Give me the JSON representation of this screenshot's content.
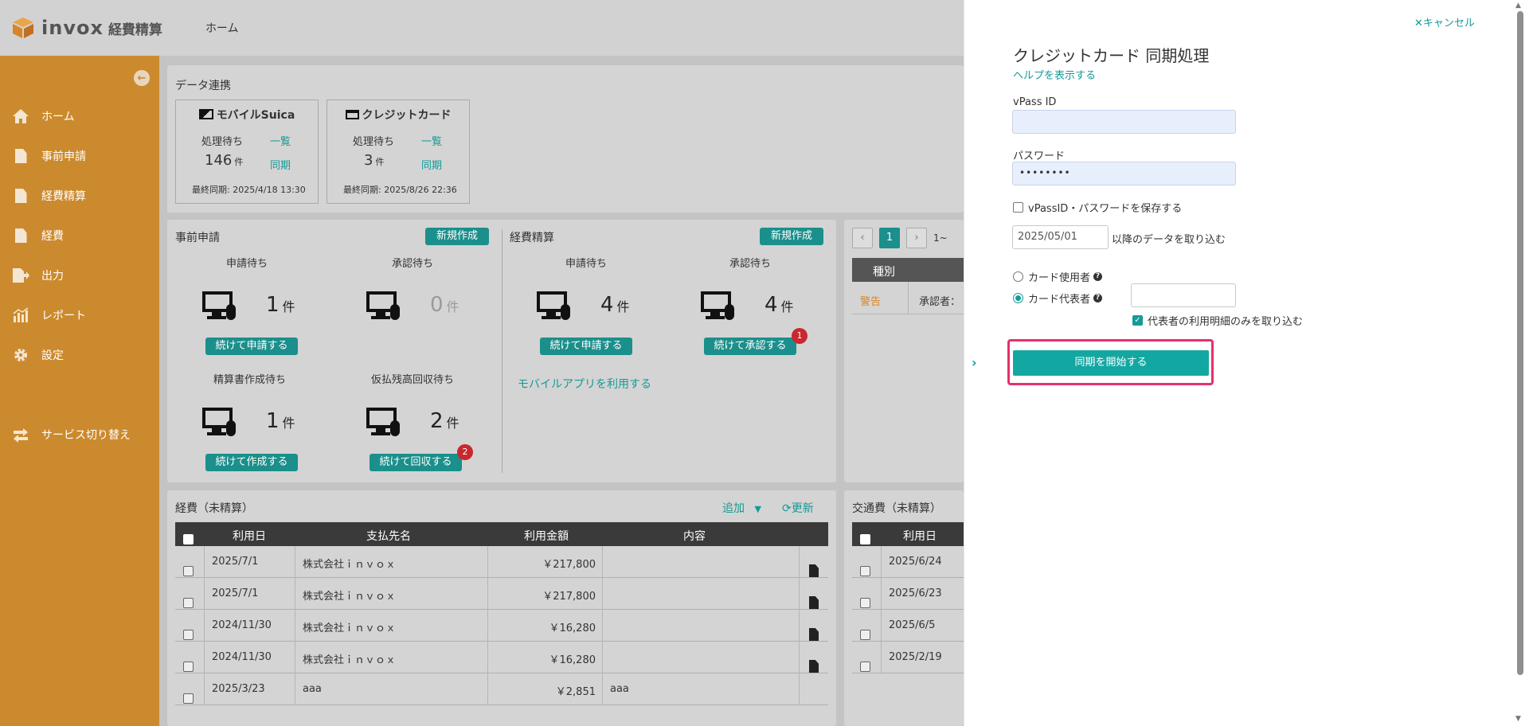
{
  "header": {
    "logo_text": "invox",
    "logo_sub": "経費精算",
    "home_link": "ホーム"
  },
  "sidebar": {
    "items": [
      {
        "label": "ホーム",
        "icon": "home-icon"
      },
      {
        "label": "事前申請",
        "icon": "document-icon"
      },
      {
        "label": "経費精算",
        "icon": "document-icon"
      },
      {
        "label": "経費",
        "icon": "document-icon"
      },
      {
        "label": "出力",
        "icon": "export-icon"
      },
      {
        "label": "レポート",
        "icon": "chart-icon"
      },
      {
        "label": "設定",
        "icon": "gear-icon"
      },
      {
        "label": "サービス切り替え",
        "icon": "switch-icon"
      }
    ]
  },
  "data_link": {
    "title": "データ連携",
    "suica": {
      "title": "モバイルSuica",
      "pending_label": "処理待ち",
      "count": "146",
      "unit": "件",
      "list_link": "一覧",
      "sync_link": "同期",
      "last_sync": "最終同期: 2025/4/18 13:30"
    },
    "credit": {
      "title": "クレジットカード",
      "pending_label": "処理待ち",
      "count": "3",
      "unit": "件",
      "list_link": "一覧",
      "sync_link": "同期",
      "last_sync": "最終同期: 2025/8/26 22:36"
    }
  },
  "pre_app": {
    "title": "事前申請",
    "new_button": "新規作成",
    "blocks": [
      {
        "label": "申請待ち",
        "count": "1",
        "unit": "件",
        "button": "続けて申請する"
      },
      {
        "label": "承認待ち",
        "count": "0",
        "unit": "件"
      },
      {
        "label": "精算書作成待ち",
        "count": "1",
        "unit": "件",
        "button": "続けて作成する"
      },
      {
        "label": "仮払残高回収待ち",
        "count": "2",
        "unit": "件",
        "button": "続けて回収する",
        "badge": "2"
      }
    ]
  },
  "expense_settle": {
    "title": "経費精算",
    "new_button": "新規作成",
    "blocks": [
      {
        "label": "申請待ち",
        "count": "4",
        "unit": "件",
        "button": "続けて申請する"
      },
      {
        "label": "承認待ち",
        "count": "4",
        "unit": "件",
        "button": "続けて承認する",
        "badge": "1"
      }
    ],
    "mobile_link": "モバイルアプリを利用する"
  },
  "right_panel": {
    "page": "1",
    "range_text": "1~",
    "col_kind": "種別",
    "warning": "警告",
    "approver": "承認者："
  },
  "expenses": {
    "title": "経費（未精算）",
    "add_label": "追加",
    "refresh_label": "更新",
    "columns": [
      "利用日",
      "支払先名",
      "利用金額",
      "内容"
    ],
    "rows": [
      {
        "date": "2025/7/1",
        "payee": "株式会社ｉｎｖｏｘ",
        "amount": "￥217,800",
        "content": "",
        "file": true
      },
      {
        "date": "2025/7/1",
        "payee": "株式会社ｉｎｖｏｘ",
        "amount": "￥217,800",
        "content": "",
        "file": true
      },
      {
        "date": "2024/11/30",
        "payee": "株式会社ｉｎｖｏｘ",
        "amount": "￥16,280",
        "content": "",
        "file": true
      },
      {
        "date": "2024/11/30",
        "payee": "株式会社ｉｎｖｏｘ",
        "amount": "￥16,280",
        "content": "",
        "file": true
      },
      {
        "date": "2025/3/23",
        "payee": "aaa",
        "amount": "￥2,851",
        "content": "aaa",
        "file": false
      }
    ]
  },
  "transport": {
    "title": "交通費（未精算）",
    "columns": [
      "利用日"
    ],
    "rows": [
      "2025/6/24",
      "2025/6/23",
      "2025/6/5",
      "2025/2/19"
    ]
  },
  "drawer": {
    "cancel": "キャンセル",
    "title": "クレジットカード 同期処理",
    "help": "ヘルプを表示する",
    "vpass_label": "vPass ID",
    "vpass_value": "",
    "password_label": "パスワード",
    "password_value": "••••••••",
    "save_label": "vPassID・パスワードを保存する",
    "date_value": "2025/05/01",
    "date_suffix": "以降のデータを取り込む",
    "card_user_label": "カード使用者",
    "card_rep_label": "カード代表者",
    "rep_only_label": "代表者の利用明細のみを取り込む",
    "sync_button": "同期を開始する"
  },
  "colors": {
    "teal": "#139b97",
    "sidebar": "#cc8a2e",
    "highlight": "#e4326a",
    "badge": "#c9282e"
  }
}
